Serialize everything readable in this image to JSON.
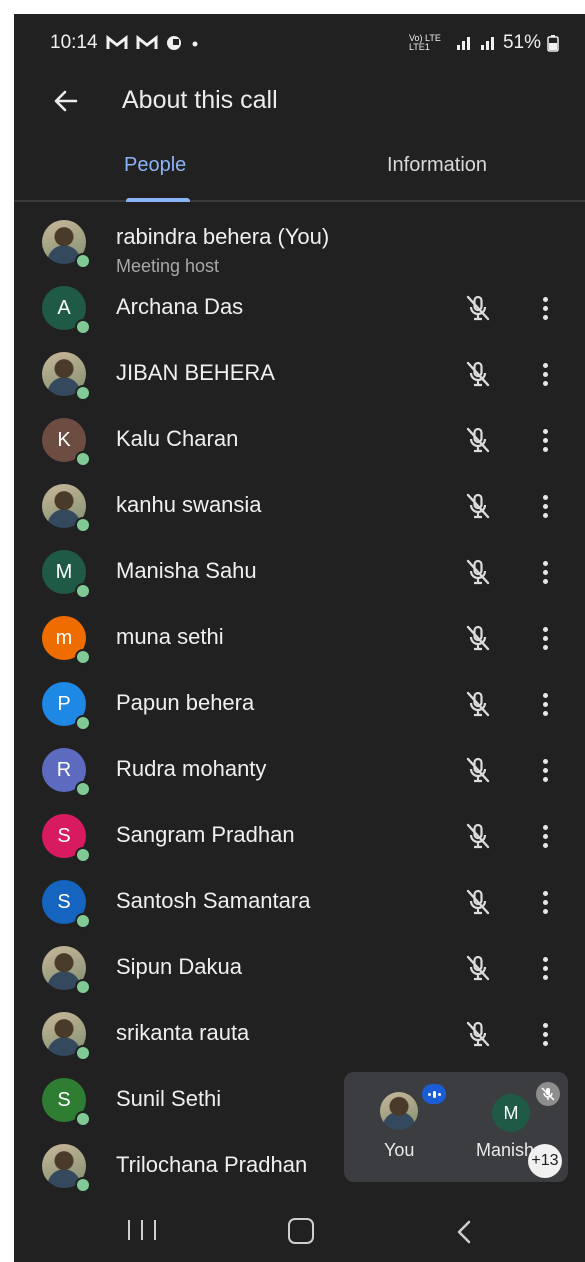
{
  "status_bar": {
    "time": "10:14",
    "notification_icons": [
      "gmail-icon",
      "gmail-icon",
      "chat-icon",
      "dot-icon"
    ],
    "network": "Vo) LTE LTE1",
    "battery": "51%"
  },
  "header": {
    "title": "About this call",
    "back_icon": "arrow-left-icon"
  },
  "tabs": [
    {
      "label": "People",
      "selected": true
    },
    {
      "label": "Information",
      "selected": false
    }
  ],
  "participants": [
    {
      "name": "rabindra behera (You)",
      "subtitle": "Meeting host",
      "avatar_type": "photo"
    },
    {
      "name": "Archana Das",
      "initial": "A",
      "color": "#1e5a45",
      "avatar_type": "initial"
    },
    {
      "name": "JIBAN BEHERA",
      "avatar_type": "photo"
    },
    {
      "name": "Kalu Charan",
      "initial": "K",
      "color": "#6d4c41",
      "avatar_type": "initial"
    },
    {
      "name": "kanhu swansia",
      "avatar_type": "photo"
    },
    {
      "name": "Manisha Sahu",
      "initial": "M",
      "color": "#1e5a45",
      "avatar_type": "initial"
    },
    {
      "name": "muna sethi",
      "initial": "m",
      "color": "#ef6c00",
      "avatar_type": "initial"
    },
    {
      "name": "Papun behera",
      "initial": "P",
      "color": "#1e88e5",
      "avatar_type": "initial"
    },
    {
      "name": "Rudra mohanty",
      "initial": "R",
      "color": "#5c6bc0",
      "avatar_type": "initial"
    },
    {
      "name": "Sangram Pradhan",
      "initial": "S",
      "color": "#d81b60",
      "avatar_type": "initial"
    },
    {
      "name": "Santosh Samantara",
      "initial": "S",
      "color": "#1565c0",
      "avatar_type": "initial"
    },
    {
      "name": "Sipun Dakua",
      "avatar_type": "photo"
    },
    {
      "name": "srikanta rauta",
      "avatar_type": "photo"
    },
    {
      "name": "Sunil Sethi",
      "initial": "S",
      "color": "#2e7d32",
      "avatar_type": "initial"
    },
    {
      "name": "Trilochana Pradhan",
      "avatar_type": "photo"
    }
  ],
  "pip": {
    "you_label": "You",
    "other_initial": "M",
    "other_label": "Manish",
    "more_count": "+13"
  },
  "colors": {
    "accent": "#8ab4f8",
    "background": "#212121",
    "online": "#81c995"
  },
  "nav": [
    "recents-icon",
    "home-icon",
    "back-icon"
  ]
}
